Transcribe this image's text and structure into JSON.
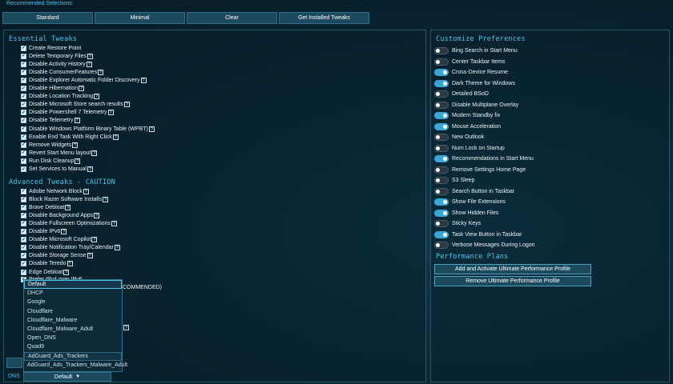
{
  "top_label": "Recommended Selections:",
  "presets": [
    "Standard",
    "Minimal",
    "Clear",
    "Get Installed Tweaks"
  ],
  "essential": {
    "title": "Essential Tweaks",
    "items": [
      {
        "label": "Create Restore Point",
        "checked": true,
        "help": false
      },
      {
        "label": "Delete Temporary Files",
        "checked": true,
        "help": true
      },
      {
        "label": "Disable Activity History",
        "checked": true,
        "help": true
      },
      {
        "label": "Disable ConsumerFeatures",
        "checked": true,
        "help": true
      },
      {
        "label": "Disable Explorer Automatic Folder Discovery",
        "checked": true,
        "help": true
      },
      {
        "label": "Disable Hibernation",
        "checked": true,
        "help": true
      },
      {
        "label": "Disable Location Tracking",
        "checked": true,
        "help": true
      },
      {
        "label": "Disable Microsoft Store search results",
        "checked": true,
        "help": true
      },
      {
        "label": "Disable Powershell 7 Telemetry",
        "checked": true,
        "help": true
      },
      {
        "label": "Disable Telemetry",
        "checked": true,
        "help": true
      },
      {
        "label": "Disable Windows Platform Binary Table (WPBT)",
        "checked": true,
        "help": true
      },
      {
        "label": "Enable End Task With Right Click",
        "checked": true,
        "help": true
      },
      {
        "label": "Remove Widgets",
        "checked": true,
        "help": true
      },
      {
        "label": "Revert Start Menu layout",
        "checked": true,
        "help": true
      },
      {
        "label": "Run Disk Cleanup",
        "checked": true,
        "help": true
      },
      {
        "label": "Set Services to Manual",
        "checked": true,
        "help": true
      }
    ]
  },
  "advanced": {
    "title": "Advanced Tweaks - CAUTION",
    "items": [
      {
        "label": "Adobe Network Block",
        "checked": true,
        "help": true
      },
      {
        "label": "Block Razer Software Installs",
        "checked": true,
        "help": true
      },
      {
        "label": "Brave Debloat",
        "checked": true,
        "help": true
      },
      {
        "label": "Disable Background Apps",
        "checked": true,
        "help": true
      },
      {
        "label": "Disable Fullscreen Optimizations",
        "checked": true,
        "help": true
      },
      {
        "label": "Disable IPv6",
        "checked": true,
        "help": true
      },
      {
        "label": "Disable Microsoft Copilot",
        "checked": true,
        "help": true
      },
      {
        "label": "Disable Notification Tray/Calendar",
        "checked": true,
        "help": true
      },
      {
        "label": "Disable Storage Sense",
        "checked": true,
        "help": true
      },
      {
        "label": "Disable Teredo",
        "checked": true,
        "help": true
      },
      {
        "label": "Edge Debloat",
        "checked": true,
        "help": true
      }
    ],
    "partial_item": "Prefer IPv4 over IPv6",
    "partial_recommended": "COMMENDED)"
  },
  "dns": {
    "label": "DNS",
    "selected": "Default",
    "options": [
      "Default",
      "DHCP",
      "Google",
      "Cloudflare",
      "Cloudflare_Malware",
      "Cloudflare_Malware_Adult",
      "Open_DNS",
      "Quad9",
      "AdGuard_Ads_Trackers",
      "AdGuard_Ads_Trackers_Malware_Adult"
    ]
  },
  "preferences": {
    "title": "Customize Preferences",
    "items": [
      {
        "label": "Bing Search in Start Menu",
        "on": false
      },
      {
        "label": "Center Taskbar Items",
        "on": false
      },
      {
        "label": "Cross-Device Resume",
        "on": true
      },
      {
        "label": "Dark Theme for Windows",
        "on": true
      },
      {
        "label": "Detailed BSoD",
        "on": false
      },
      {
        "label": "Disable Multiplane Overlay",
        "on": false
      },
      {
        "label": "Modern Standby fix",
        "on": true
      },
      {
        "label": "Mouse Acceleration",
        "on": true
      },
      {
        "label": "New Outlook",
        "on": false
      },
      {
        "label": "Num Lock on Startup",
        "on": false
      },
      {
        "label": "Recommendations in Start Menu",
        "on": true
      },
      {
        "label": "Remove Settings Home Page",
        "on": false
      },
      {
        "label": "S3 Sleep",
        "on": false
      },
      {
        "label": "Search Button in Taskbar",
        "on": false
      },
      {
        "label": "Show File Extensions",
        "on": true
      },
      {
        "label": "Show Hidden Files",
        "on": true
      },
      {
        "label": "Sticky Keys",
        "on": false
      },
      {
        "label": "Task View Button in Taskbar",
        "on": true
      },
      {
        "label": "Verbose Messages During Logon",
        "on": false
      }
    ]
  },
  "performance": {
    "title": "Performance Plans",
    "buttons": [
      "Add and Activate Ultimate Performance Profile",
      "Remove Ultimate Performance Profile"
    ]
  },
  "colors": {
    "accent": "#4fc3e8",
    "toggle_on": "#3aa6d8",
    "button_bg": "#1b4a5e"
  },
  "icons": {
    "help": "question-mark-icon",
    "check": "checkmark-icon",
    "caret": "chevron-down-icon"
  }
}
